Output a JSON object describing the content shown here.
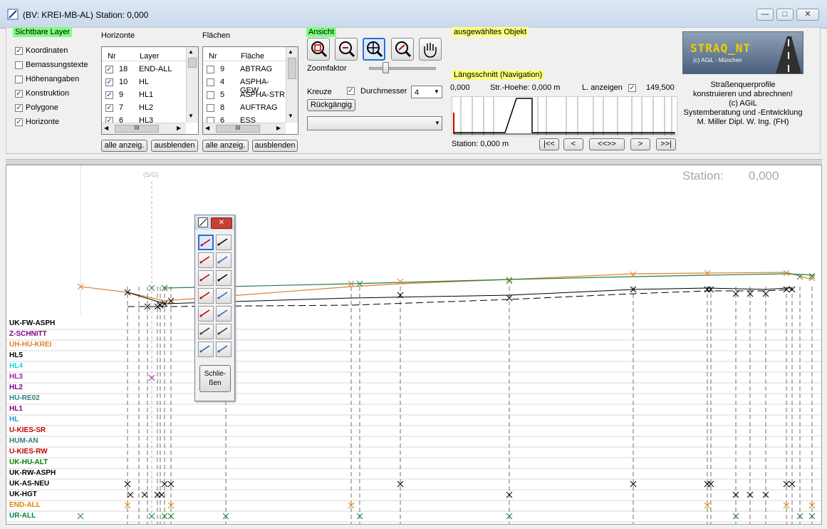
{
  "window": {
    "title": "(BV: KREI-MB-AL)   Station:      0,000"
  },
  "sichtbare_layer": {
    "title": "Sichtbare Layer",
    "items": [
      {
        "label": "Koordinaten",
        "checked": true
      },
      {
        "label": "Bemassungstexte",
        "checked": false
      },
      {
        "label": "Höhenangaben",
        "checked": false
      },
      {
        "label": "Konstruktion",
        "checked": true
      },
      {
        "label": "Polygone",
        "checked": true
      },
      {
        "label": "Horizonte",
        "checked": true
      }
    ]
  },
  "horizonte": {
    "title": "Horizonte",
    "col_nr": "Nr",
    "col_layer": "Layer",
    "rows": [
      {
        "nr": "18",
        "name": "END-ALL",
        "checked": true
      },
      {
        "nr": "10",
        "name": "HL",
        "checked": true
      },
      {
        "nr": "9",
        "name": "HL1",
        "checked": true
      },
      {
        "nr": "7",
        "name": "HL2",
        "checked": true
      },
      {
        "nr": "6",
        "name": "HL3",
        "checked": true
      }
    ],
    "show_all": "alle anzeig.",
    "hide": "ausblenden"
  },
  "flaechen": {
    "title": "Flächen",
    "col_nr": "Nr",
    "col_flaeche": "Fläche",
    "rows": [
      {
        "nr": "9",
        "name": "ABTRAG",
        "checked": false
      },
      {
        "nr": "4",
        "name": "ASPHA-GEW",
        "checked": false
      },
      {
        "nr": "5",
        "name": "ASPHA-STR",
        "checked": false
      },
      {
        "nr": "8",
        "name": "AUFTRAG",
        "checked": false
      },
      {
        "nr": "6",
        "name": "ESS",
        "checked": false
      }
    ],
    "show_all": "alle anzeig.",
    "hide": "ausblenden"
  },
  "ansicht": {
    "title": "Ansicht",
    "zoomfaktor": "Zoomfaktor",
    "kreuze": "Kreuze",
    "durchmesser": "Durchmesser",
    "durchmesser_value": "4",
    "undo": "Rückgängig"
  },
  "objekt": {
    "title": "ausgewähltes Objekt"
  },
  "laengsschnitt": {
    "title": "Längsschnitt (Navigation)",
    "start": "0,000",
    "str_hoehe": "Str.-Hoehe:  0,000 m",
    "l_anzeigen": "L. anzeigen",
    "end": "149,500",
    "station": "Station: 0,000 m",
    "nav": [
      "|<<",
      "<",
      "<<>>",
      ">",
      ">>|"
    ]
  },
  "logo": {
    "name": "STRAQ_NT",
    "sub": "(c) AGiL - München",
    "lines": [
      "Straßenquerprofile",
      "konstruieren und abrechnen!",
      "(c) AGiL",
      "Systemberatung und -Entwicklung",
      "M. Miller Dipl. W. Ing. (FH)"
    ]
  },
  "canvas": {
    "station_label": "Station:",
    "station_value": "0,000",
    "axis_label": "(S/G)",
    "layers": [
      {
        "name": "UK-FW-ASPH",
        "color": "#000000"
      },
      {
        "name": "Z-SCHNITT",
        "color": "#800080"
      },
      {
        "name": "UH-HU-KREI",
        "color": "#e08030"
      },
      {
        "name": "HL5",
        "color": "#000000"
      },
      {
        "name": "HL4",
        "color": "#20d0e0"
      },
      {
        "name": "HL3",
        "color": "#a020a0"
      },
      {
        "name": "HL2",
        "color": "#800080"
      },
      {
        "name": "HU-RE02",
        "color": "#308080"
      },
      {
        "name": "HL1",
        "color": "#800080"
      },
      {
        "name": "HL",
        "color": "#3090e0"
      },
      {
        "name": "U-KIES-SR",
        "color": "#c00000"
      },
      {
        "name": "HUM-AN",
        "color": "#308080"
      },
      {
        "name": "U-KIES-RW",
        "color": "#c00000"
      },
      {
        "name": "UK-HU-ALT",
        "color": "#008000"
      },
      {
        "name": "UK-RW-ASPH",
        "color": "#000000"
      },
      {
        "name": "UK-AS-NEU",
        "color": "#000000"
      },
      {
        "name": "UK-HGT",
        "color": "#000000"
      },
      {
        "name": "END-ALL",
        "color": "#e08000"
      },
      {
        "name": "UR-ALL",
        "color": "#008040"
      }
    ]
  },
  "tool_palette": {
    "close_label": "Schlie-\nßen"
  }
}
